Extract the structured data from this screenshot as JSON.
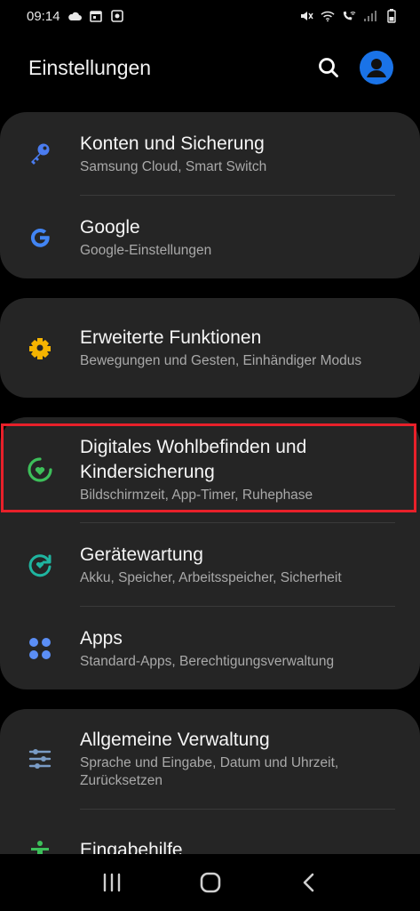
{
  "status_bar": {
    "time": "09:14",
    "icons_left": [
      "cloud-icon",
      "calendar-icon",
      "record-icon"
    ],
    "icons_right": [
      "mute-icon",
      "wifi-icon",
      "call-wifi-icon",
      "signal-icon",
      "battery-icon"
    ]
  },
  "header": {
    "title": "Einstellungen",
    "search_icon": "search-icon",
    "profile_icon": "profile-icon",
    "accent": "#1a73e8"
  },
  "groups": [
    {
      "items": [
        {
          "title": "Konten und Sicherung",
          "subtitle": "Samsung Cloud, Smart Switch",
          "icon": "key-icon",
          "icon_color": "#4a7cf0"
        },
        {
          "title": "Google",
          "subtitle": "Google-Einstellungen",
          "icon": "google-icon",
          "icon_color": "#4285f4"
        }
      ]
    },
    {
      "items": [
        {
          "title": "Erweiterte Funktionen",
          "subtitle": "Bewegungen und Gesten, Einhändiger Modus",
          "icon": "puzzle-gear-icon",
          "icon_color": "#f5b400"
        }
      ]
    },
    {
      "items": [
        {
          "title": "Digitales Wohlbefinden und Kindersicherung",
          "subtitle": "Bildschirmzeit, App-Timer, Ruhephase",
          "icon": "wellbeing-icon",
          "icon_color": "#3dbf5a",
          "highlighted": true
        },
        {
          "title": "Gerätewartung",
          "subtitle": "Akku, Speicher, Arbeitsspeicher, Sicherheit",
          "icon": "device-care-icon",
          "icon_color": "#1fb5a0"
        },
        {
          "title": "Apps",
          "subtitle": "Standard-Apps, Berechtigungsverwaltung",
          "icon": "apps-icon",
          "icon_color": "#5b8ef5"
        }
      ]
    },
    {
      "items": [
        {
          "title": "Allgemeine Verwaltung",
          "subtitle": "Sprache und Eingabe, Datum und Uhrzeit, Zurücksetzen",
          "icon": "sliders-icon",
          "icon_color": "#7a9cc6"
        },
        {
          "title": "Eingabehilfe",
          "subtitle": "",
          "icon": "accessibility-icon",
          "icon_color": "#3dbf5a"
        }
      ]
    }
  ],
  "highlight_color": "#e8202a",
  "navbar": {
    "recent_icon": "recent-apps-icon",
    "home_icon": "home-icon",
    "back_icon": "back-icon"
  }
}
